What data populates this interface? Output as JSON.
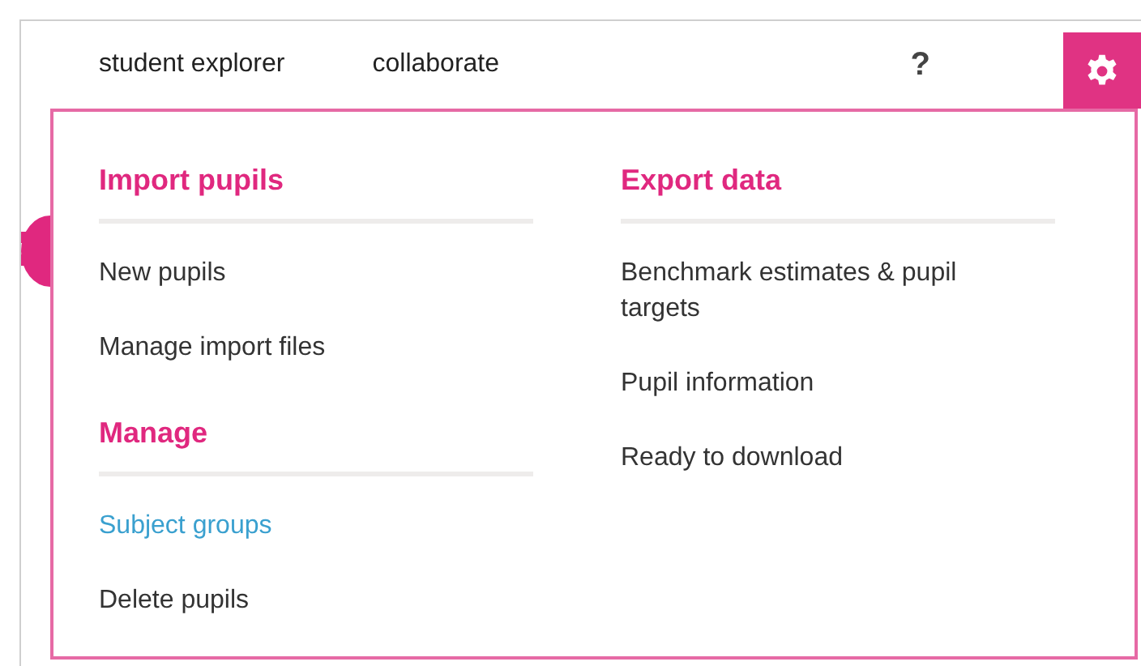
{
  "nav": {
    "links": [
      {
        "label": "student explorer"
      },
      {
        "label": "collaborate"
      }
    ],
    "help": "?"
  },
  "menu": {
    "columns": [
      {
        "sections": [
          {
            "heading": "Import pupils",
            "items": [
              {
                "label": "New pupils",
                "active": false
              },
              {
                "label": "Manage import files",
                "active": false
              }
            ]
          },
          {
            "heading": "Manage",
            "items": [
              {
                "label": "Subject groups",
                "active": true
              },
              {
                "label": "Delete pupils",
                "active": false
              }
            ]
          }
        ]
      },
      {
        "sections": [
          {
            "heading": "Export data",
            "items": [
              {
                "label": "Benchmark estimates & pupil targets",
                "active": false
              },
              {
                "label": "Pupil information",
                "active": false
              },
              {
                "label": "Ready to download",
                "active": false
              }
            ]
          }
        ]
      }
    ]
  }
}
